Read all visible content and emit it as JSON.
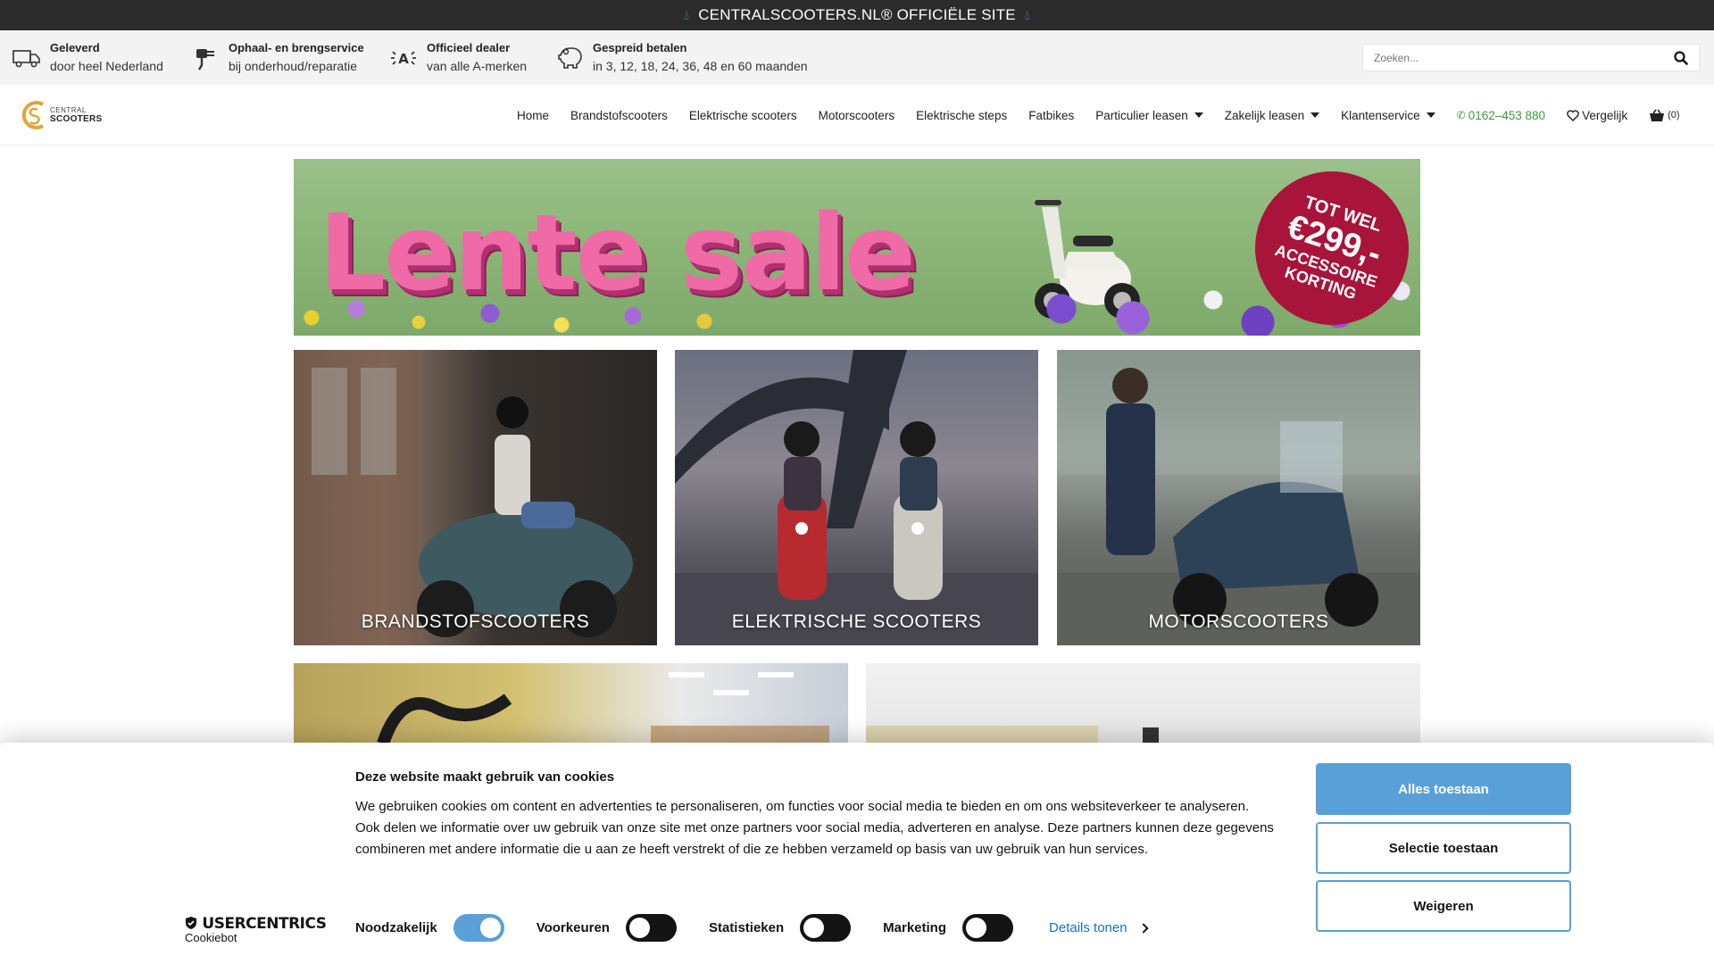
{
  "topbar": {
    "text": "CENTRALSCOOTERS.NL® OFFICIËLE SITE"
  },
  "usps": [
    {
      "icon": "truck-icon",
      "title": "Geleverd",
      "sub": "door heel Nederland"
    },
    {
      "icon": "wrench-icon",
      "title": "Ophaal- en brengservice",
      "sub": "bij onderhoud/reparatie"
    },
    {
      "icon": "a-badge-icon",
      "title": "Officieel dealer",
      "sub": "van alle A-merken"
    },
    {
      "icon": "piggy-bank-icon",
      "title": "Gespreid betalen",
      "sub": "in 3, 12, 18, 24, 36, 48 en 60 maanden"
    }
  ],
  "search": {
    "placeholder": "Zoeken..."
  },
  "logo": {
    "small": "CENTRAL",
    "big": "SCOOTERS"
  },
  "nav": {
    "items": [
      "Home",
      "Brandstofscooters",
      "Elektrische scooters",
      "Motorscooters",
      "Elektrische steps",
      "Fatbikes",
      "Particulier leasen",
      "Zakelijk leasen",
      "Klantenservice"
    ],
    "phone": "0162–453 880",
    "compare": "Vergelijk",
    "cart_count": "(0)"
  },
  "banner": {
    "headline": "Lente sale",
    "badge_line1": "TOT WEL",
    "badge_line2": "€299,-",
    "badge_line3": "ACCESSOIRE",
    "badge_line4": "KORTING"
  },
  "tiles": [
    "BRANDSTOFSCOOTERS",
    "ELEKTRISCHE SCOOTERS",
    "MOTORSCOOTERS"
  ],
  "cookie": {
    "title": "Deze website maakt gebruik van cookies",
    "body": "We gebruiken cookies om content en advertenties te personaliseren, om functies voor social media te bieden en om ons websiteverkeer te analyseren. Ook delen we informatie over uw gebruik van onze site met onze partners voor social media, adverteren en analyse. Deze partners kunnen deze gegevens combineren met andere informatie die u aan ze heeft verstrekt of die ze hebben verzameld op basis van uw gebruik van hun services.",
    "brand": "USERCENTRICS",
    "brand_sub": "Cookiebot",
    "toggles": [
      {
        "label": "Noodzakelijk",
        "on": true
      },
      {
        "label": "Voorkeuren",
        "on": false
      },
      {
        "label": "Statistieken",
        "on": false
      },
      {
        "label": "Marketing",
        "on": false
      }
    ],
    "details": "Details tonen",
    "btn_allow_all": "Alles toestaan",
    "btn_allow_selection": "Selectie toestaan",
    "btn_deny": "Weigeren"
  },
  "colors": {
    "accent": "#5aa0d8",
    "phone": "#3a9b3a",
    "topbar": "#2b2b2b",
    "badge": "#a8143a"
  }
}
